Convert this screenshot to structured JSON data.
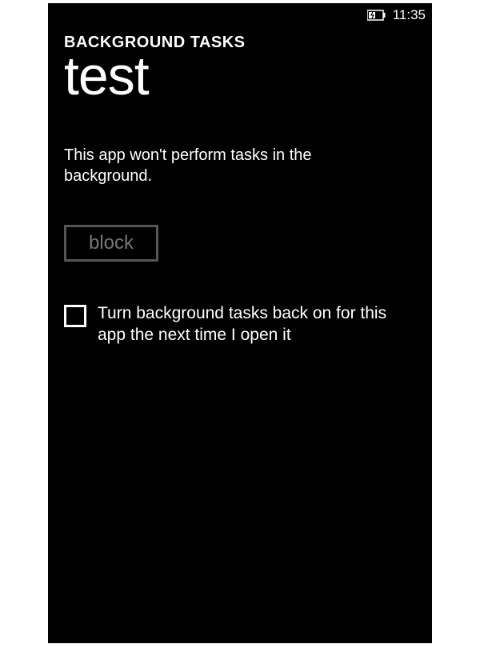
{
  "statusBar": {
    "time": "11:35"
  },
  "header": {
    "section": "BACKGROUND TASKS",
    "title": "test"
  },
  "main": {
    "description": "This app won't perform tasks in the background.",
    "blockButtonLabel": "block",
    "checkboxLabel": "Turn background tasks back on for this app the next time I open it",
    "checkboxChecked": false
  }
}
